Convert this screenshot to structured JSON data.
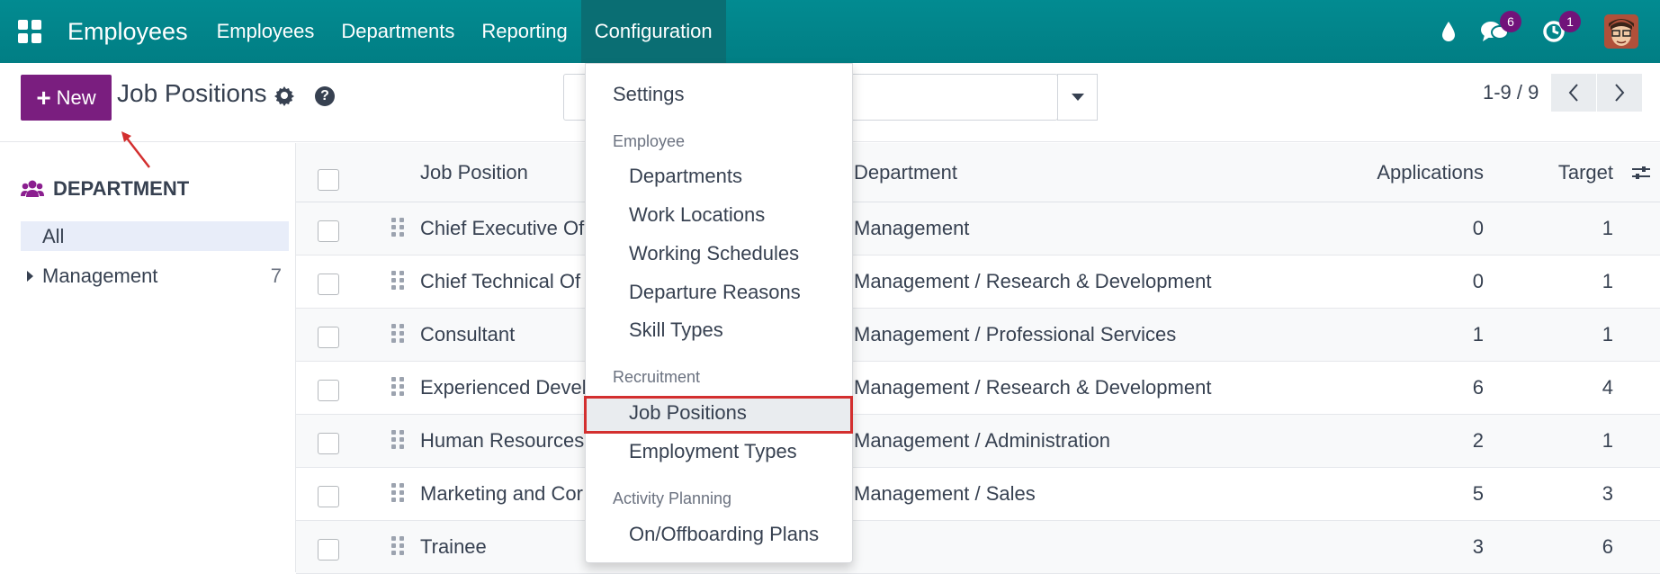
{
  "topbar": {
    "app_name": "Employees",
    "menu": [
      "Employees",
      "Departments",
      "Reporting",
      "Configuration"
    ],
    "active_menu": "Configuration",
    "messages_badge": "6",
    "activities_badge": "1",
    "colors": {
      "bar": "#017e84",
      "badge": "#71137a"
    }
  },
  "controlbar": {
    "new_label": "New",
    "title": "Job Positions",
    "pager": "1-9 / 9",
    "prev": "<",
    "next": ">",
    "help": "?"
  },
  "sidepanel": {
    "header": "DEPARTMENT",
    "items": [
      {
        "label": "All",
        "count": ""
      },
      {
        "label": "Management",
        "count": "7"
      }
    ]
  },
  "table": {
    "headers": {
      "job": "Job Position",
      "department": "Department",
      "applications": "Applications",
      "target": "Target"
    },
    "rows": [
      {
        "job": "Chief Executive Of",
        "department": "Management",
        "applications": "0",
        "target": "1"
      },
      {
        "job": "Chief Technical Of",
        "department": "Management / Research & Development",
        "applications": "0",
        "target": "1"
      },
      {
        "job": "Consultant",
        "department": "Management / Professional Services",
        "applications": "1",
        "target": "1"
      },
      {
        "job": "Experienced Devel",
        "department": "Management / Research & Development",
        "applications": "6",
        "target": "4"
      },
      {
        "job": "Human Resources",
        "department": "Management / Administration",
        "applications": "2",
        "target": "1"
      },
      {
        "job": "Marketing and Cor",
        "department": "Management / Sales",
        "applications": "5",
        "target": "3"
      },
      {
        "job": "Trainee",
        "department": "",
        "applications": "3",
        "target": "6"
      }
    ]
  },
  "dropdown": {
    "settings": "Settings",
    "section_employee": "Employee",
    "employee_items": [
      "Departments",
      "Work Locations",
      "Working Schedules",
      "Departure Reasons",
      "Skill Types"
    ],
    "section_recruitment": "Recruitment",
    "recruitment_items": [
      "Job Positions",
      "Employment Types"
    ],
    "section_activity": "Activity Planning",
    "activity_items": [
      "On/Offboarding Plans"
    ],
    "highlight_color": "#d32f2f"
  }
}
